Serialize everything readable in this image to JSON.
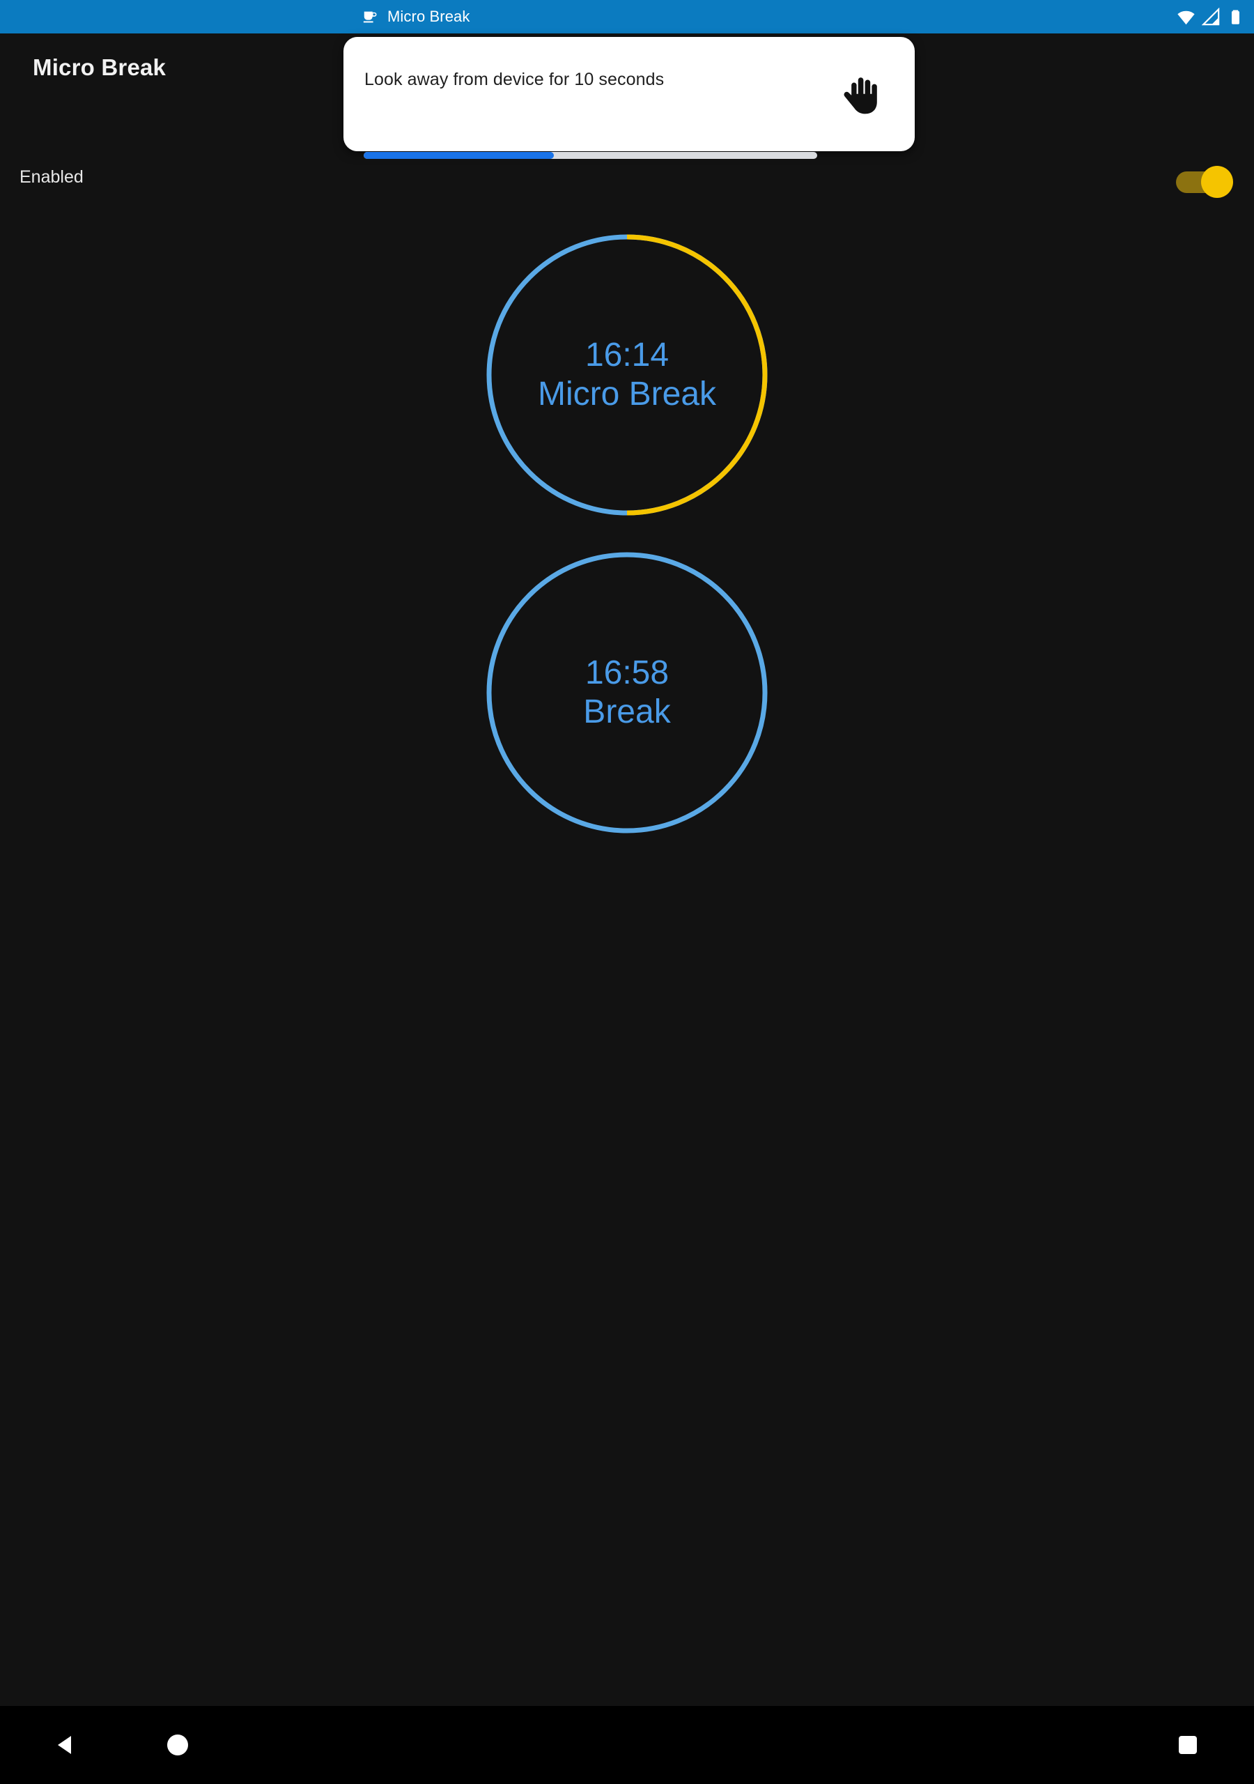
{
  "status_bar": {
    "background_color": "#0B7BC0",
    "notification_icon": "coffee-cup-icon",
    "notification_label": "Micro Break",
    "icons": [
      "wifi-icon",
      "cellular-signal-icon",
      "battery-icon"
    ]
  },
  "app_bar": {
    "title": "Micro Break"
  },
  "notification": {
    "message": "Look away from device for 10 seconds",
    "icon": "raised-hand-icon",
    "progress_percent": 42,
    "progress_fill_color": "#1A73E8",
    "progress_track_color": "#dadce0",
    "card_color": "#ffffff"
  },
  "settings": {
    "enabled_label": "Enabled",
    "enabled_state": "on",
    "toggle_track_color": "#8C7210",
    "toggle_thumb_color": "#F5C400"
  },
  "timers": [
    {
      "time": "16:14",
      "name": "Micro Break",
      "ring_base_color": "#5AA9E6",
      "ring_progress_color": "#F5C400",
      "progress_percent": 50,
      "text_color": "#4A9BE8"
    },
    {
      "time": "16:58",
      "name": "Break",
      "ring_base_color": "#5AA9E6",
      "ring_progress_color": "#5AA9E6",
      "progress_percent": 0,
      "text_color": "#4A9BE8"
    }
  ],
  "nav_bar": {
    "background_color": "#000000",
    "buttons": [
      {
        "name": "back-button",
        "icon": "back-triangle-icon"
      },
      {
        "name": "home-button",
        "icon": "home-circle-icon"
      },
      {
        "name": "recents-button",
        "icon": "recents-square-icon"
      }
    ]
  },
  "theme": {
    "page_background": "#121212",
    "accent_blue": "#5AA9E6",
    "accent_gold": "#F5C400"
  }
}
